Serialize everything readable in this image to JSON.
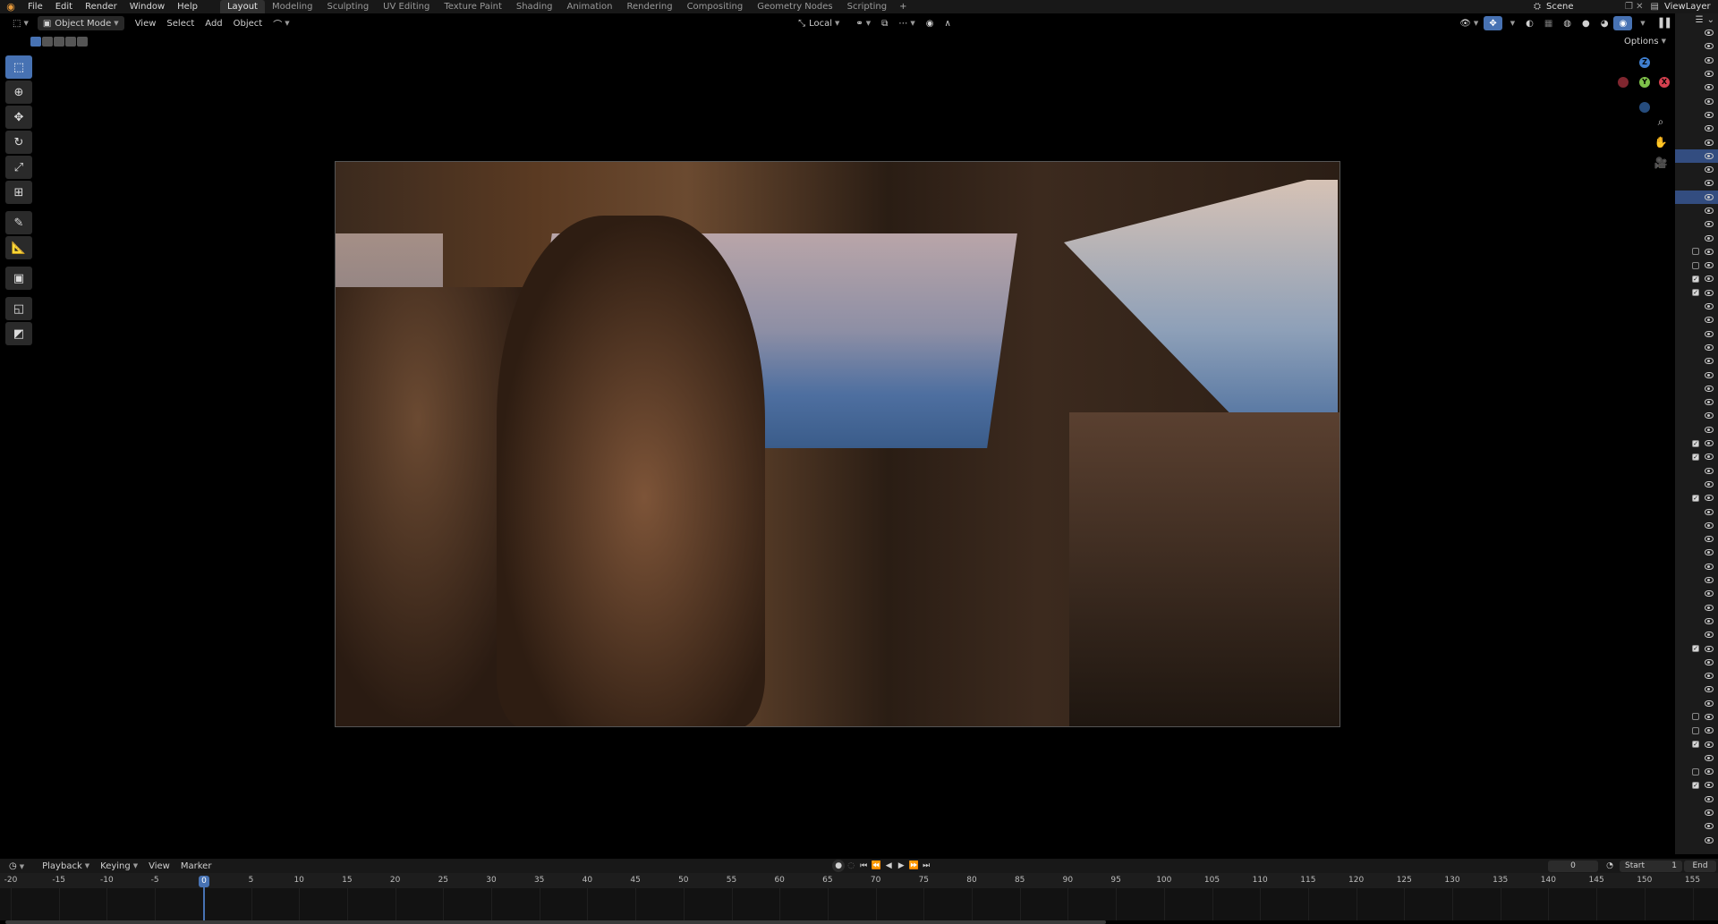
{
  "topbar": {
    "menus": [
      "File",
      "Edit",
      "Render",
      "Window",
      "Help"
    ],
    "workspaces": [
      "Layout",
      "Modeling",
      "Sculpting",
      "UV Editing",
      "Texture Paint",
      "Shading",
      "Animation",
      "Rendering",
      "Compositing",
      "Geometry Nodes",
      "Scripting"
    ],
    "active_workspace": "Layout",
    "add_tab": "+",
    "scene": "Scene",
    "view_layer": "ViewLayer"
  },
  "viewport_header": {
    "mode": "Object Mode",
    "menus": [
      "View",
      "Select",
      "Add",
      "Object"
    ],
    "transform_orientation": "Local",
    "options": "Options"
  },
  "tools": [
    {
      "name": "select-box",
      "icon": "select-box-icon",
      "active": true
    },
    {
      "name": "cursor",
      "icon": "cursor-icon"
    },
    {
      "name": "move",
      "icon": "move-icon"
    },
    {
      "name": "rotate",
      "icon": "rotate-icon"
    },
    {
      "name": "scale",
      "icon": "scale-icon"
    },
    {
      "name": "transform",
      "icon": "transform-icon"
    },
    {
      "name": "annotate",
      "icon": "annotate-icon"
    },
    {
      "name": "measure",
      "icon": "measure-icon"
    },
    {
      "name": "add-cube",
      "icon": "add-cube-icon"
    },
    {
      "name": "shear",
      "icon": "shear-icon"
    },
    {
      "name": "camera-frame",
      "icon": "camera-frame-icon"
    }
  ],
  "gizmo": {
    "x_label": "X",
    "y_label": "Y",
    "z_label": "Z",
    "x_color": "#d5404f",
    "y_color": "#7ec24a",
    "z_color": "#3f7fd0"
  },
  "outliner": {
    "rows": [
      {
        "kind": "eye"
      },
      {
        "kind": "eye"
      },
      {
        "kind": "eye"
      },
      {
        "kind": "eye"
      },
      {
        "kind": "eye"
      },
      {
        "kind": "eye"
      },
      {
        "kind": "eye"
      },
      {
        "kind": "eye"
      },
      {
        "kind": "eye"
      },
      {
        "kind": "eye",
        "selected": true
      },
      {
        "kind": "eye"
      },
      {
        "kind": "eye"
      },
      {
        "kind": "eye",
        "selected": true
      },
      {
        "kind": "eye"
      },
      {
        "kind": "eye"
      },
      {
        "kind": "eye"
      },
      {
        "kind": "cb-off"
      },
      {
        "kind": "cb-off"
      },
      {
        "kind": "cb-on"
      },
      {
        "kind": "cb-on"
      },
      {
        "kind": "eye"
      },
      {
        "kind": "eye"
      },
      {
        "kind": "eye"
      },
      {
        "kind": "eye"
      },
      {
        "kind": "eye"
      },
      {
        "kind": "eye"
      },
      {
        "kind": "eye"
      },
      {
        "kind": "eye"
      },
      {
        "kind": "eye"
      },
      {
        "kind": "eye"
      },
      {
        "kind": "cb-on"
      },
      {
        "kind": "cb-on"
      },
      {
        "kind": "eye"
      },
      {
        "kind": "eye"
      },
      {
        "kind": "cb-on"
      },
      {
        "kind": "eye"
      },
      {
        "kind": "eye"
      },
      {
        "kind": "eye"
      },
      {
        "kind": "eye"
      },
      {
        "kind": "eye"
      },
      {
        "kind": "eye"
      },
      {
        "kind": "eye"
      },
      {
        "kind": "eye"
      },
      {
        "kind": "eye"
      },
      {
        "kind": "eye"
      },
      {
        "kind": "cb-on"
      },
      {
        "kind": "eye"
      },
      {
        "kind": "eye"
      },
      {
        "kind": "eye"
      },
      {
        "kind": "eye"
      },
      {
        "kind": "cb-off"
      },
      {
        "kind": "cb-off"
      },
      {
        "kind": "cb-on"
      },
      {
        "kind": "eye"
      },
      {
        "kind": "cb-off"
      },
      {
        "kind": "cb-on"
      },
      {
        "kind": "eye"
      },
      {
        "kind": "eye"
      },
      {
        "kind": "eye"
      },
      {
        "kind": "eye"
      }
    ]
  },
  "timeline": {
    "menus": [
      "Playback",
      "Keying",
      "View",
      "Marker"
    ],
    "current_frame": "0",
    "start_label": "Start",
    "start_value": "1",
    "end_label": "End",
    "playhead": "0",
    "ticks": [
      "-20",
      "-15",
      "-10",
      "-5",
      "0",
      "5",
      "10",
      "15",
      "20",
      "25",
      "30",
      "35",
      "40",
      "45",
      "50",
      "55",
      "60",
      "65",
      "70",
      "75",
      "80",
      "85",
      "90",
      "95",
      "100",
      "105",
      "110",
      "115",
      "120",
      "125",
      "130",
      "135",
      "140",
      "145",
      "150",
      "155"
    ]
  }
}
